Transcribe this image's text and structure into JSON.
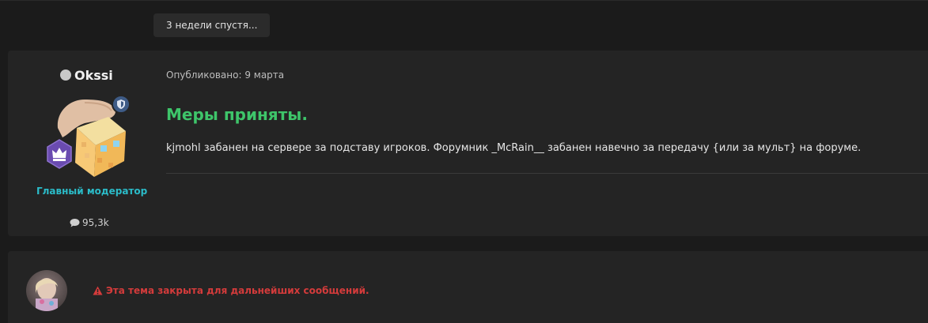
{
  "time_gap": {
    "label": "3 недели спустя..."
  },
  "post": {
    "author": {
      "name": "Okssi",
      "online_status": "offline",
      "role": "Главный модератор",
      "role_color": "#2bbcc9",
      "reaction_count": "95,3k"
    },
    "posted": "Опубликовано: 9 марта",
    "title": "Меры приняты.",
    "title_color": "#3ec56a",
    "text": "kjmohl забанен на сервере за подставу игроков. Форумник _McRain__ забанен навечно за передачу {или за мульт} на форуме."
  },
  "closed_notice": {
    "text": "Эта тема закрыта для дальнейших сообщений.",
    "color": "#d43b3b",
    "icon": "warning-icon"
  }
}
